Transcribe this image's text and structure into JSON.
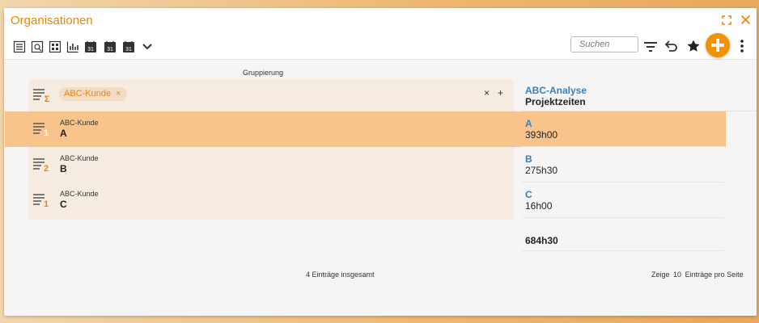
{
  "window": {
    "title": "Organisationen",
    "accent": "#e8860c",
    "buttons": {
      "maximize_icon": "expand-icon",
      "close_icon": "close-icon",
      "close_glyph": "✕",
      "maximize_glyph": "⛶"
    }
  },
  "toolbar": {
    "left_icons": [
      "list-view-icon",
      "detail-view-icon",
      "tile-view-icon",
      "chart-view-icon",
      "calendar-day-icon",
      "calendar-week-icon",
      "calendar-month-icon",
      "chevron-down-icon"
    ],
    "calendar_badge": "31",
    "search": {
      "placeholder": "Suchen",
      "value": ""
    },
    "right_icons": [
      "filter-icon",
      "undo-icon",
      "star-icon",
      "add-icon",
      "more-vertical-icon"
    ],
    "add_color": "#f39200"
  },
  "grouping": {
    "label": "Gruppierung",
    "chip_label": "ABC-Kunde",
    "chip_remove": "×",
    "clear": "×",
    "add": "+"
  },
  "rows": [
    {
      "group_label": "ABC-Kunde",
      "value": "A",
      "count": "1",
      "selected": true
    },
    {
      "group_label": "ABC-Kunde",
      "value": "B",
      "count": "2",
      "selected": false
    },
    {
      "group_label": "ABC-Kunde",
      "value": "C",
      "count": "1",
      "selected": false
    }
  ],
  "right_column": {
    "header_title": "ABC-Analyse",
    "header_subtitle": "Projektzeiten",
    "cells": [
      {
        "key": "A",
        "value": "393h00"
      },
      {
        "key": "B",
        "value": "275h30"
      },
      {
        "key": "C",
        "value": "16h00"
      }
    ],
    "total": "684h30"
  },
  "footer": {
    "count_text": "4 Einträge insgesamt",
    "page_prefix": "Zeige",
    "page_size": "10",
    "page_suffix": "Einträge pro Seite"
  },
  "colors": {
    "selected_row": "#f8c48c",
    "group_bg": "#f5ebe0",
    "link_blue": "#3a7fb8"
  }
}
